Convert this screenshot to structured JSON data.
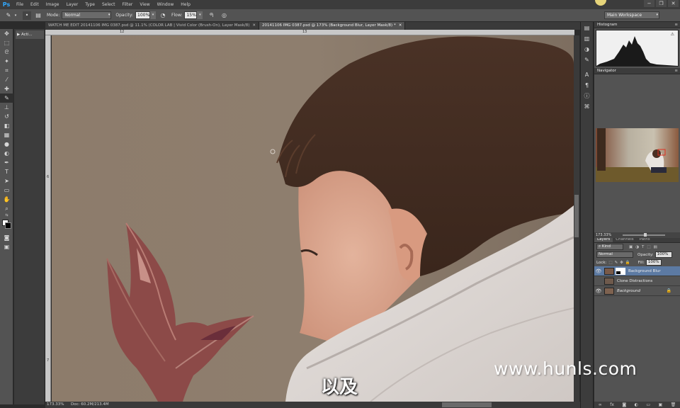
{
  "app": {
    "logo": "Ps"
  },
  "menubar": {
    "items": [
      "File",
      "Edit",
      "Image",
      "Layer",
      "Type",
      "Select",
      "Filter",
      "View",
      "Window",
      "Help"
    ],
    "window_controls": [
      "−",
      "❐",
      "✕"
    ]
  },
  "options_bar": {
    "mode_label": "Mode:",
    "mode_value": "Normal",
    "opacity_label": "Opacity:",
    "opacity_value": "100%",
    "flow_label": "Flow:",
    "flow_value": "15%",
    "workspace": "Main Workspace"
  },
  "actions_panel": {
    "label": "Acti..."
  },
  "document_tabs": [
    {
      "label": "WATCH ME EDIT 20141106 IMG 0387.psd @ 11.1% (COLOR LAB | Vivid Color (Brush-On), Layer Mask/8)",
      "close": "✕",
      "active": false
    },
    {
      "label": "20141106 IMG 0387.psd @ 173% (Background Blur, Layer Mask/8) *",
      "close": "✕",
      "active": true
    }
  ],
  "rulers": {
    "top": [
      "12",
      "13"
    ],
    "left": [
      "6",
      "7"
    ]
  },
  "status_bar": {
    "zoom": "173.33%",
    "doc": "Doc: 60.2M/213.4M"
  },
  "panels": {
    "histogram": {
      "title": "Histogram"
    },
    "navigator": {
      "title": "Navigator",
      "zoom": "173.33%"
    },
    "layers": {
      "tabs": [
        "Layers",
        "Channels",
        "Paths"
      ],
      "kind_filter": "Kind",
      "blend_mode": "Normal",
      "opacity_label": "Opacity:",
      "opacity_value": "100%",
      "lock_label": "Lock:",
      "fill_label": "Fill:",
      "fill_value": "100%",
      "items": [
        {
          "name": "Background Blur",
          "visible": true,
          "selected": true,
          "has_mask": true
        },
        {
          "name": "Clone Distractions",
          "visible": false,
          "selected": false,
          "has_mask": false
        },
        {
          "name": "Background",
          "visible": true,
          "selected": false,
          "has_mask": false,
          "locked": true
        }
      ]
    }
  },
  "overlay": {
    "watermark": "www.hunls.com",
    "subtitle": "以及"
  },
  "colors": {
    "panel_bg": "#535353",
    "selected_layer": "#5c7aa3",
    "canvas_bg": "#8d7d6c"
  }
}
